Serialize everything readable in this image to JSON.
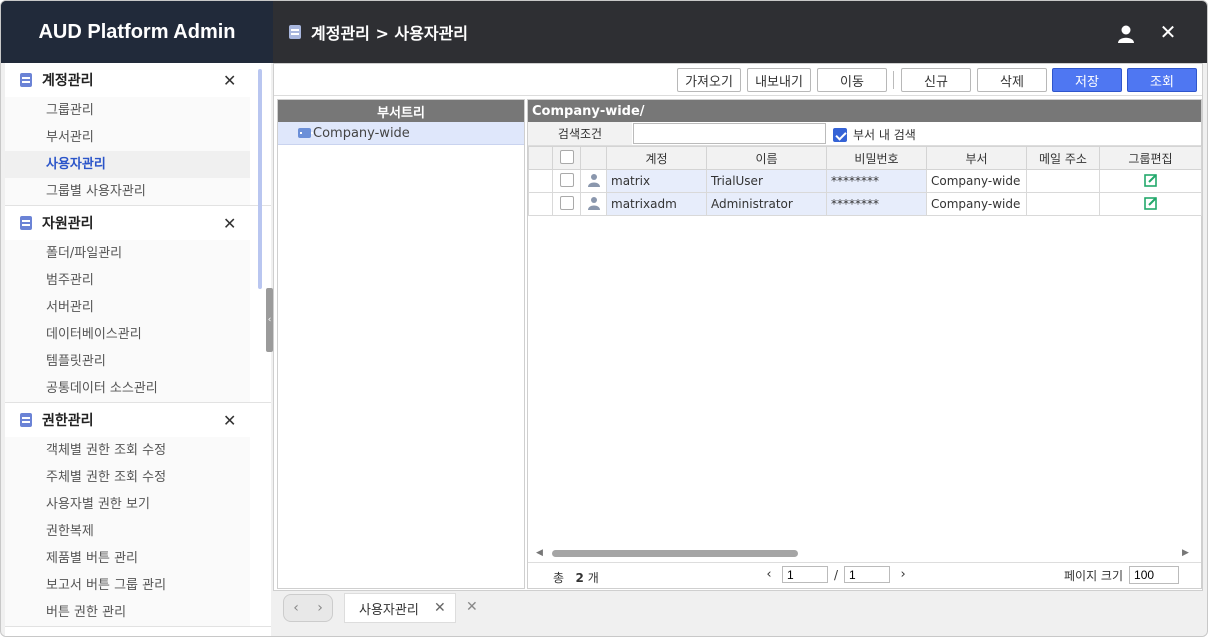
{
  "app": {
    "title": "AUD Platform Admin"
  },
  "breadcrumb": {
    "text": "계정관리 > 사용자관리"
  },
  "header": {
    "user_icon": "user-icon",
    "close_glyph": "✕"
  },
  "colors": {
    "accent": "#4f77f2",
    "doc_icon": "#6b83d6",
    "header_bg": "#2e2f33",
    "brand_bg": "#212a3a",
    "active_menu": "#2b55c9"
  },
  "sidebar": {
    "groups": [
      {
        "title": "계정관리",
        "items": [
          "그룹관리",
          "부서관리",
          "사용자관리",
          "그룹별 사용자관리"
        ],
        "active": 2
      },
      {
        "title": "자원관리",
        "items": [
          "폴더/파일관리",
          "범주관리",
          "서버관리",
          "데이터베이스관리",
          "템플릿관리",
          "공통데이터 소스관리"
        ]
      },
      {
        "title": "권한관리",
        "items": [
          "객체별 권한 조회 수정",
          "주체별 권한 조회 수정",
          "사용자별 권한 보기",
          "권한복제",
          "제품별 버튼 관리",
          "보고서 버튼 그룹 관리",
          "버튼 권한 관리"
        ]
      }
    ]
  },
  "toolbar": {
    "import": "가져오기",
    "export": "내보내기",
    "move": "이동",
    "new": "신규",
    "delete": "삭제",
    "save": "저장",
    "search": "조회"
  },
  "tree": {
    "header": "부서트리",
    "nodes": [
      "Company-wide"
    ]
  },
  "grid": {
    "path": "Company-wide/",
    "search_label": "검색조건",
    "search_value": "",
    "dept_search_label": "부서 내 검색",
    "dept_search_checked": true,
    "columns": [
      "계정",
      "이름",
      "비밀번호",
      "부서",
      "메일 주소",
      "그룹편집"
    ],
    "rows": [
      {
        "account": "matrix",
        "name": "TrialUser",
        "password": "********",
        "dept": "Company-wide",
        "email": ""
      },
      {
        "account": "matrixadm",
        "name": "Administrator",
        "password": "********",
        "dept": "Company-wide",
        "email": ""
      }
    ]
  },
  "footer": {
    "total_label": "총",
    "total_count": "2",
    "total_unit": "개",
    "page_current": "1",
    "page_total": "1",
    "page_sep": "/",
    "page_size_label": "페이지 크기",
    "page_size": "100"
  },
  "tabs": [
    {
      "label": "사용자관리"
    }
  ]
}
